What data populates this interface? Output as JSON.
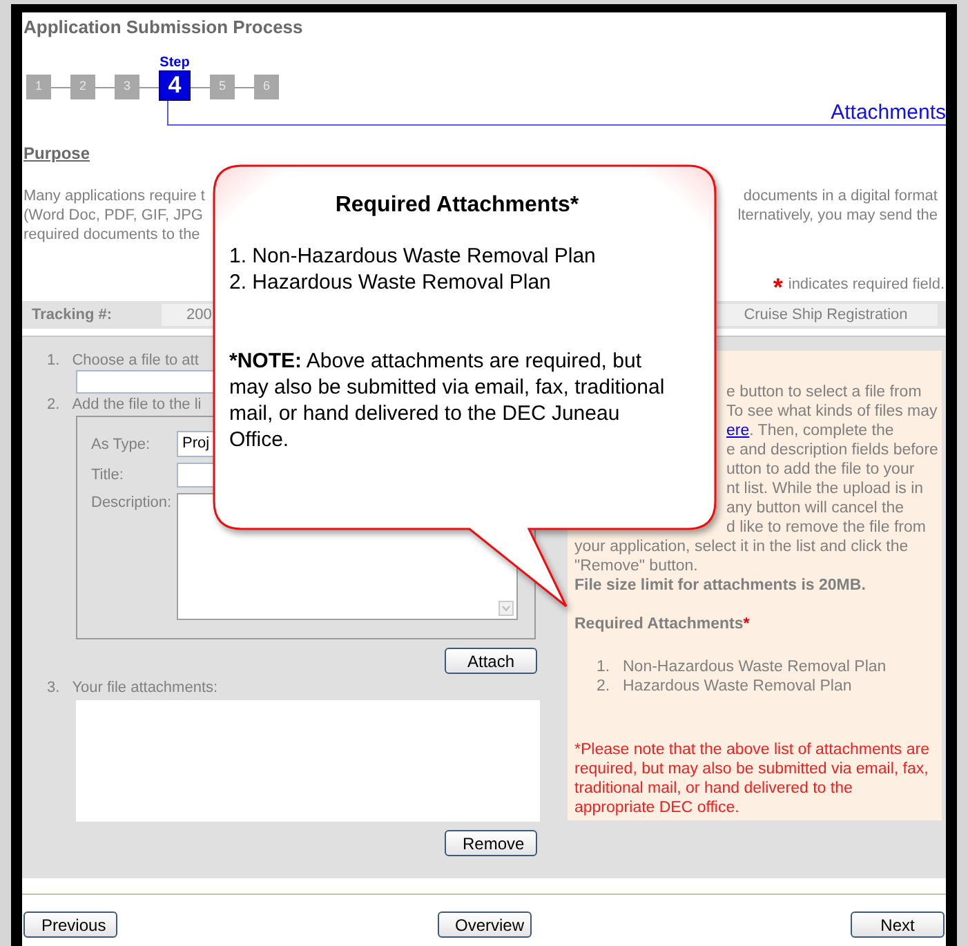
{
  "title": "Application Submission Process",
  "step_caption": "Step",
  "steps": [
    {
      "label": "1",
      "selected": false
    },
    {
      "label": "2",
      "selected": false
    },
    {
      "label": "3",
      "selected": false
    },
    {
      "label": "4",
      "selected": true
    },
    {
      "label": "5",
      "selected": false
    },
    {
      "label": "6",
      "selected": false
    }
  ],
  "section_title": "Attachments",
  "purpose": {
    "heading": "Purpose",
    "lines": [
      {
        "left": "Many applications require t",
        "right": "documents in a digital format"
      },
      {
        "left": "(Word Doc, PDF, GIF, JPG",
        "right": "lternatively, you may send the"
      },
      {
        "left": "required documents to the"
      }
    ]
  },
  "required_note": {
    "mark": "*",
    "text": "indicates required field."
  },
  "tracking": {
    "label": "Tracking #:",
    "value": "200",
    "type": "Cruise Ship Registration"
  },
  "form": {
    "step1": {
      "number": "1.",
      "label": "Choose a file to att"
    },
    "step2": {
      "number": "2.",
      "label": "Add the file to the li",
      "type_label": "As Type:",
      "type_value": "Proj",
      "title_label": "Title:",
      "description_label": "Description:"
    },
    "attach_button": "Attach",
    "step3": {
      "number": "3.",
      "label": "Your file attachments:"
    },
    "remove_button": "Remove"
  },
  "help": {
    "lines": [
      {
        "text": "e button to select a file from"
      },
      {
        "text": "To see what kinds of files may"
      },
      {
        "link": "ere",
        "text": ". Then, complete the"
      },
      {
        "text": "e and description fields before"
      },
      {
        "text": "utton to add the file to your"
      },
      {
        "text": "nt list.  While the upload is in"
      },
      {
        "text": "any button will cancel the"
      },
      {
        "text": "d like to remove the file from"
      }
    ],
    "full_lines": [
      "your application, select it in the list and click the",
      "\"Remove\" button."
    ],
    "size_limit": "File size limit for attachments is 20MB.",
    "required_heading": "Required Attachments",
    "required_mark": "*",
    "required_items": [
      {
        "number": "1.",
        "text": "Non-Hazardous Waste Removal Plan"
      },
      {
        "number": "2.",
        "text": "Hazardous Waste Removal Plan"
      }
    ],
    "note": "*Please note that the above list of attachments are required, but may also be submitted via email, fax, traditional mail, or hand delivered to the appropriate DEC office."
  },
  "callout": {
    "title": "Required Attachments*",
    "items": [
      "1. Non-Hazardous Waste Removal Plan",
      "2. Hazardous Waste Removal Plan"
    ],
    "note_label": "*NOTE:",
    "note": "Above attachments are required, but may also be submitted via email, fax, traditional mail, or hand delivered to the DEC Juneau Office."
  },
  "buttons": [
    {
      "label": "Previous"
    },
    {
      "label": "Overview"
    },
    {
      "label": "Next"
    }
  ]
}
